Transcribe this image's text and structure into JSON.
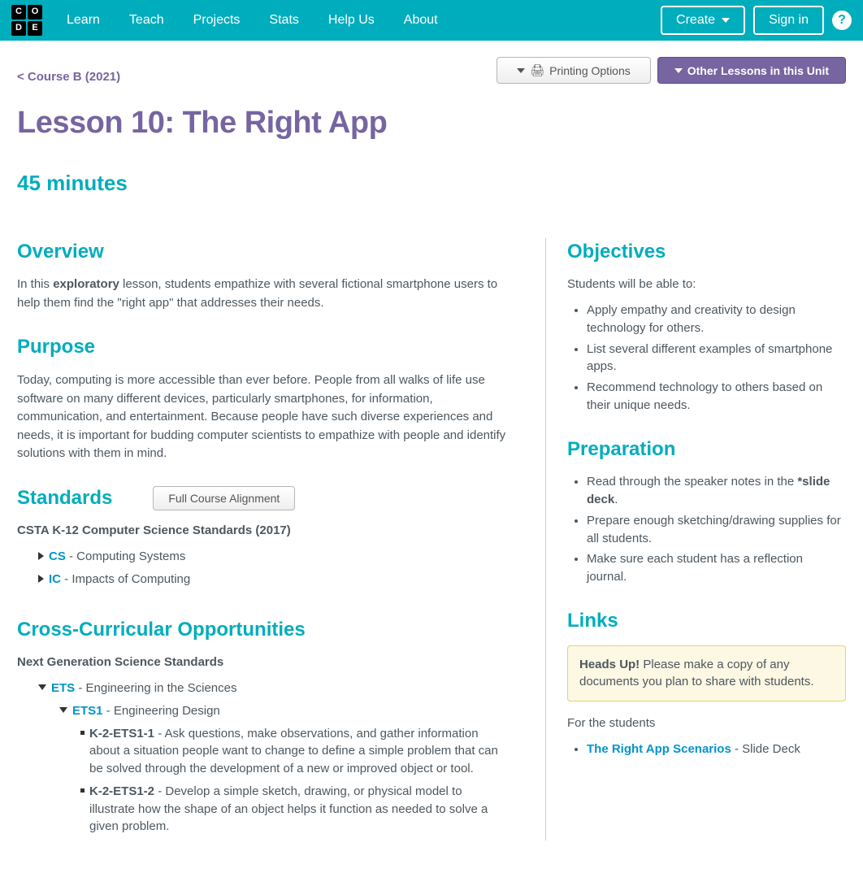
{
  "header": {
    "logo": [
      "C",
      "O",
      "D",
      "E"
    ],
    "nav": [
      "Learn",
      "Teach",
      "Projects",
      "Stats",
      "Help Us",
      "About"
    ],
    "create": "Create",
    "signin": "Sign in"
  },
  "breadcrumb": "< Course B (2021)",
  "printing": "Printing Options",
  "other_lessons": "Other Lessons in this Unit",
  "title": "Lesson 10: The Right App",
  "duration": "45 minutes",
  "overview": {
    "h": "Overview",
    "pre": "In this ",
    "bold": "exploratory",
    "post": " lesson, students empathize with several fictional smartphone users to help them find the \"right app\" that addresses their needs."
  },
  "purpose": {
    "h": "Purpose",
    "p": "Today, computing is more accessible than ever before. People from all walks of life use software on many different devices, particularly smartphones, for information, communication, and entertainment. Because people have such diverse experiences and needs, it is important for budding computer scientists to empathize with people and identify solutions with them in mind."
  },
  "standards": {
    "h": "Standards",
    "btn": "Full Course Alignment",
    "sub": "CSTA K-12 Computer Science Standards (2017)",
    "cs": {
      "code": "CS",
      "name": " - Computing Systems"
    },
    "ic": {
      "code": "IC",
      "name": " - Impacts of Computing"
    }
  },
  "cross": {
    "h": "Cross-Curricular Opportunities",
    "sub": "Next Generation Science Standards",
    "ets": {
      "code": "ETS",
      "name": " - Engineering in the Sciences"
    },
    "ets1": {
      "code": "ETS1",
      "name": " - Engineering Design"
    },
    "i1": {
      "code": "K-2-ETS1-1",
      "desc": " - Ask questions, make observations, and gather information about a situation people want to change to define a simple problem that can be solved through the development of a new or improved object or tool."
    },
    "i2": {
      "code": "K-2-ETS1-2",
      "desc": " - Develop a simple sketch, drawing, or physical model to illustrate how the shape of an object helps it function as needed to solve a given problem."
    }
  },
  "objectives": {
    "h": "Objectives",
    "intro": "Students will be able to:",
    "items": [
      "Apply empathy and creativity to design technology for others.",
      "List several different examples of smartphone apps.",
      "Recommend technology to others based on their unique needs."
    ]
  },
  "prep": {
    "h": "Preparation",
    "i0": {
      "pre": "Read through the speaker notes in the ",
      "bold": "*slide deck",
      "post": "."
    },
    "items": [
      "Prepare enough sketching/drawing supplies for all students.",
      "Make sure each student has a reflection journal."
    ]
  },
  "links": {
    "h": "Links",
    "hu_b": "Heads Up!",
    "hu_t": " Please make a copy of any documents you plan to share with students.",
    "for": "For the students",
    "l0": {
      "name": "The Right App Scenarios",
      "suffix": " - Slide Deck"
    }
  }
}
